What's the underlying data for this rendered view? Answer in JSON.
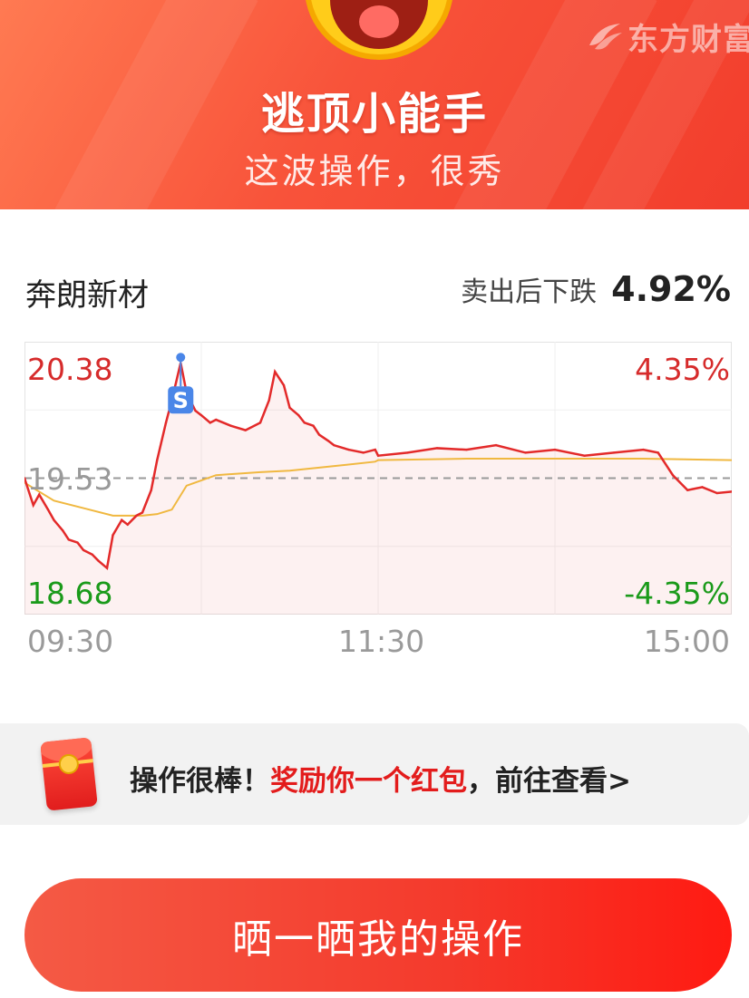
{
  "banner": {
    "title": "逃顶小能手",
    "subtitle": "这波操作，很秀",
    "brand": "东方财富"
  },
  "stock": {
    "name": "奔朗新材",
    "drop_label": "卖出后下跌",
    "drop_value": "4.92%"
  },
  "chart_data": {
    "type": "line",
    "title": "",
    "y_left_ticks": [
      "20.38",
      "19.53",
      "18.68"
    ],
    "y_right_ticks": [
      "4.35%",
      "-4.35%"
    ],
    "x_ticks": [
      "09:30",
      "11:30",
      "15:00"
    ],
    "ylim": [
      18.68,
      20.38
    ],
    "reference_price": 19.53,
    "sell_marker": {
      "label": "S",
      "time": "10:23",
      "price": 20.3
    },
    "colors": {
      "price": "#e32a2a",
      "average": "#f0b840",
      "up": "#d62b2b",
      "down": "#1a9a1a",
      "reference": "#999999"
    },
    "series": [
      {
        "role": "price",
        "x": [
          "09:30",
          "09:33",
          "09:35",
          "09:38",
          "09:40",
          "09:43",
          "09:45",
          "09:48",
          "09:50",
          "09:53",
          "09:55",
          "09:58",
          "10:00",
          "10:03",
          "10:05",
          "10:08",
          "10:10",
          "10:13",
          "10:15",
          "10:18",
          "10:20",
          "10:23",
          "10:25",
          "10:28",
          "10:30",
          "10:33",
          "10:35",
          "10:40",
          "10:45",
          "10:50",
          "10:53",
          "10:55",
          "10:58",
          "11:00",
          "11:03",
          "11:05",
          "11:08",
          "11:10",
          "11:13",
          "11:15",
          "11:20",
          "11:25",
          "11:29",
          "13:00",
          "13:10",
          "13:20",
          "13:30",
          "13:40",
          "13:50",
          "14:00",
          "14:10",
          "14:20",
          "14:30",
          "14:35",
          "14:40",
          "14:45",
          "14:50",
          "14:55",
          "15:00"
        ],
        "values": [
          19.53,
          19.35,
          19.42,
          19.32,
          19.25,
          19.18,
          19.12,
          19.1,
          19.05,
          19.02,
          18.98,
          18.93,
          19.15,
          19.25,
          19.22,
          19.28,
          19.3,
          19.45,
          19.65,
          19.9,
          20.05,
          20.3,
          20.1,
          19.98,
          19.95,
          19.9,
          19.92,
          19.88,
          19.85,
          19.9,
          20.05,
          20.24,
          20.15,
          20.0,
          19.95,
          19.9,
          19.88,
          19.82,
          19.78,
          19.75,
          19.72,
          19.7,
          19.72,
          19.68,
          19.7,
          19.73,
          19.72,
          19.75,
          19.7,
          19.72,
          19.68,
          19.7,
          19.72,
          19.7,
          19.55,
          19.45,
          19.47,
          19.43,
          19.44
        ]
      },
      {
        "role": "average",
        "x": [
          "09:30",
          "09:40",
          "09:50",
          "10:00",
          "10:10",
          "10:15",
          "10:20",
          "10:25",
          "10:35",
          "10:50",
          "11:00",
          "11:10",
          "11:29",
          "13:00",
          "13:30",
          "14:00",
          "14:30",
          "15:00"
        ],
        "values": [
          19.5,
          19.38,
          19.33,
          19.28,
          19.28,
          19.29,
          19.32,
          19.48,
          19.55,
          19.57,
          19.58,
          19.6,
          19.64,
          19.65,
          19.66,
          19.66,
          19.66,
          19.65
        ]
      }
    ]
  },
  "reward": {
    "part1": "操作很棒！",
    "part2": "奖励你一个红包",
    "part3": "，前往查看>"
  },
  "share_button": "晒一晒我的操作"
}
